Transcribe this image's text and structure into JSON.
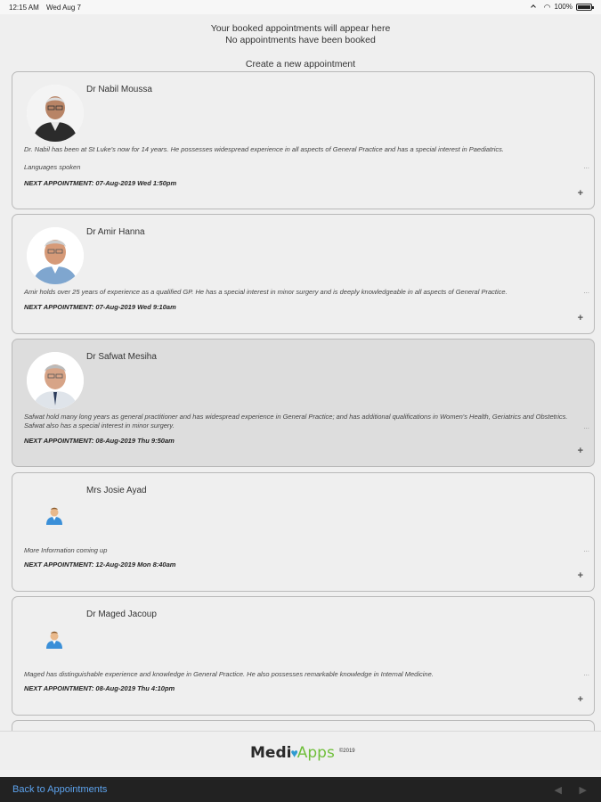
{
  "status_bar": {
    "time": "12:15 AM",
    "date": "Wed Aug 7",
    "battery": "100%"
  },
  "header": {
    "line1": "Your booked appointments will appear here",
    "line2": "No appointments have been booked",
    "create_label": "Create a new appointment"
  },
  "doctors": [
    {
      "name": "Dr Nabil Moussa",
      "bio": "Dr. Nabil has been at St Luke's now for 14 years. He possesses widespread experience in all aspects of General Practice and has a special interest in Paediatrics.",
      "languages": "Languages spoken",
      "next": "NEXT APPOINTMENT: 07-Aug-2019 Wed 1:50pm",
      "more": "...",
      "add": "+"
    },
    {
      "name": "Dr Amir Hanna",
      "bio": "Amir holds over 25 years of experience as a qualified GP. He has a special interest in minor surgery and is deeply knowledgeable in all aspects of General Practice.",
      "next": "NEXT APPOINTMENT: 07-Aug-2019 Wed 9:10am",
      "more": "...",
      "add": "+"
    },
    {
      "name": "Dr Safwat Mesiha",
      "bio": "Safwat hold many long years as general practitioner and has widespread experience in General Practice; and has additional qualifications in Women's Health, Geriatrics and Obstetrics. Safwat also has a special interest in minor surgery.",
      "next": "NEXT APPOINTMENT: 08-Aug-2019 Thu 9:50am",
      "more": "...",
      "add": "+"
    },
    {
      "name": "Mrs Josie Ayad",
      "bio": "More Information coming up",
      "next": "NEXT APPOINTMENT: 12-Aug-2019 Mon 8:40am",
      "more": "...",
      "add": "+"
    },
    {
      "name": "Dr Maged Jacoup",
      "bio": "Maged has distinguishable experience and knowledge in General Practice. He also possesses remarkable knowledge in Internal Medicine.",
      "next": "NEXT APPOINTMENT: 08-Aug-2019 Thu 4:10pm",
      "more": "...",
      "add": "+"
    }
  ],
  "footer": {
    "logo_medi": "Medi",
    "logo_apps": "Apps",
    "copyright": "©2019"
  },
  "bottom_bar": {
    "back_label": "Back to Appointments",
    "prev": "◀",
    "next": "▶"
  },
  "colors": {
    "link": "#5da3ee",
    "selected_card": "#dddddd",
    "logo_green": "#6fbf3a",
    "logo_blue": "#2f9bd1"
  }
}
